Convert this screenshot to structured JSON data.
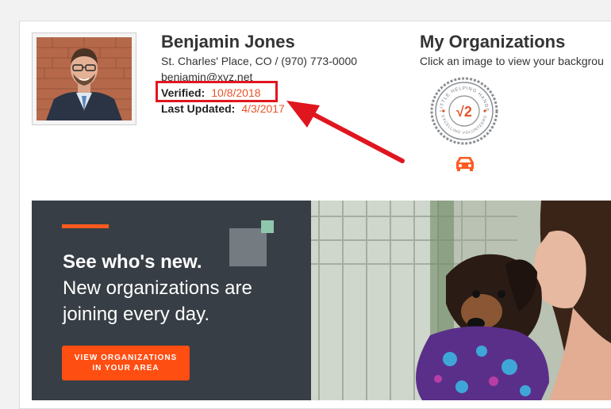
{
  "profile": {
    "name": "Benjamin Jones",
    "address": "St. Charles' Place, CO / (970) 773-0000",
    "email": "benjamin@xyz.net",
    "verified_label": "Verified:",
    "verified_date": "10/8/2018",
    "updated_label": "Last Updated:",
    "updated_date": "4/3/2017"
  },
  "organizations": {
    "title": "My Organizations",
    "subtitle": "Click an image to view your backgrou",
    "badge": {
      "top_text": "LITTLE HELPING HANDS",
      "bottom_text": "EXCELLING VOLUNTEERS",
      "mark": "√2"
    },
    "icon": "car-icon"
  },
  "banner": {
    "headline": "See who's new.",
    "line1": "New organizations are",
    "line2": "joining every day.",
    "cta_line1": "VIEW ORGANIZATIONS",
    "cta_line2": "IN YOUR AREA"
  },
  "colors": {
    "accent": "#e8542b",
    "highlight": "#e0161f",
    "banner_bg": "#373e45",
    "cta": "#ff4e12",
    "teal": "#8fc7ad"
  }
}
